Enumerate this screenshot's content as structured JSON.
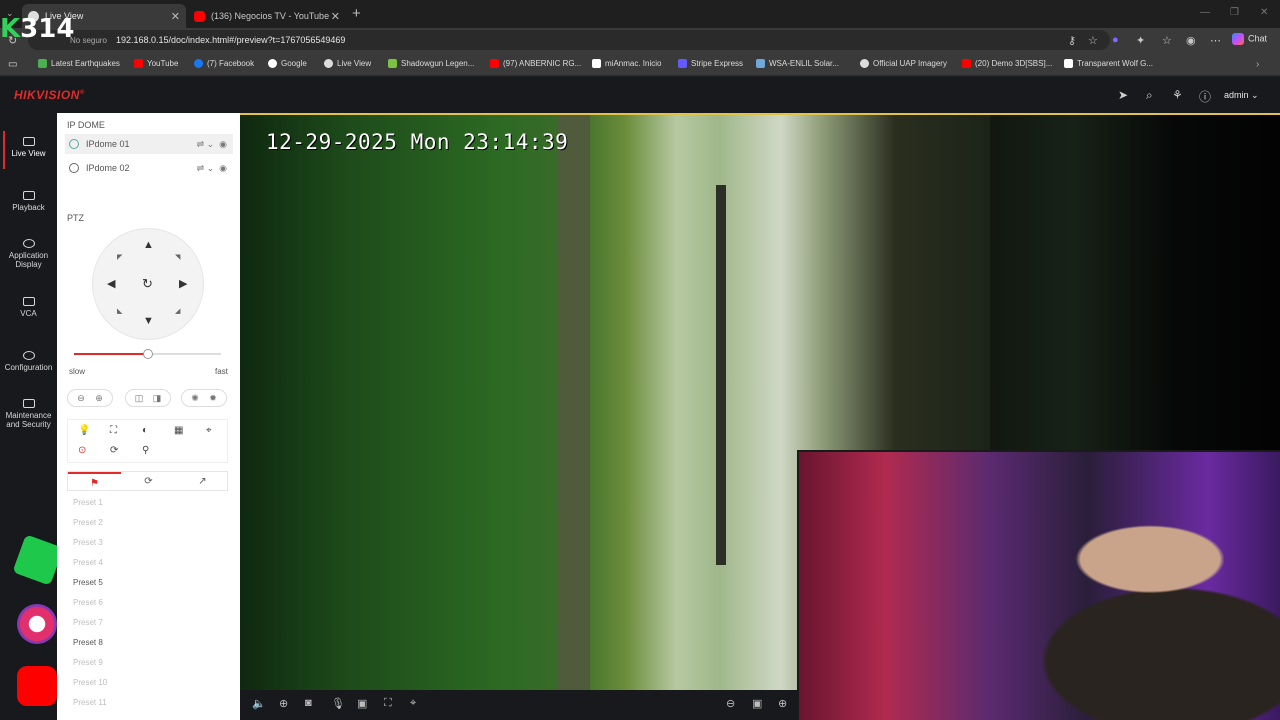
{
  "browser": {
    "tabs": [
      {
        "title": "Live View",
        "active": true
      },
      {
        "title": "(136) Negocios TV - YouTube",
        "active": false
      }
    ],
    "security_label": "No seguro",
    "url": "192.168.0.15/doc/index.html#/preview?t=1767056549469",
    "chat_label": "Chat",
    "bookmarks": [
      {
        "label": "Latest Earthquakes",
        "color": "#4caf50"
      },
      {
        "label": "YouTube",
        "color": "#ff0000"
      },
      {
        "label": "(7) Facebook",
        "color": "#1877f2"
      },
      {
        "label": "Google",
        "color": "#ffffff"
      },
      {
        "label": "Live View",
        "color": "#dddddd"
      },
      {
        "label": "Shadowgun Legen...",
        "color": "#7bc142"
      },
      {
        "label": "(97) ANBERNIC RG...",
        "color": "#ff0000"
      },
      {
        "label": "miAnmac. Inicio",
        "color": "#ffffff"
      },
      {
        "label": "Stripe Express",
        "color": "#635bff"
      },
      {
        "label": "WSA-ENLIL Solar...",
        "color": "#6fa8dc"
      },
      {
        "label": "Official UAP Imagery",
        "color": "#dddddd"
      },
      {
        "label": "(20) Demo 3D[SBS]...",
        "color": "#ff0000"
      },
      {
        "label": "Transparent Wolf G...",
        "color": "#ffffff"
      }
    ]
  },
  "overlay": {
    "text": "314",
    "prefix": "K"
  },
  "app": {
    "brand": "HIKVISION",
    "brand_mark": "®",
    "user": "admin",
    "nav": [
      {
        "label": "Live View",
        "active": true
      },
      {
        "label": "Playback"
      },
      {
        "label": "Application Display"
      },
      {
        "label": "VCA"
      },
      {
        "label": "Configuration"
      },
      {
        "label": "Maintenance and Security"
      }
    ],
    "panel": {
      "group_title": "IP DOME",
      "cameras": [
        "IPdome 01",
        "IPdome 02"
      ],
      "ptz_title": "PTZ",
      "speed_slow": "slow",
      "speed_fast": "fast",
      "speed_level": 0.5,
      "presets": [
        {
          "label": "Preset 1",
          "set": false
        },
        {
          "label": "Preset 2",
          "set": false
        },
        {
          "label": "Preset 3",
          "set": false
        },
        {
          "label": "Preset 4",
          "set": false
        },
        {
          "label": "Preset 5",
          "set": true
        },
        {
          "label": "Preset 6",
          "set": false
        },
        {
          "label": "Preset 7",
          "set": false
        },
        {
          "label": "Preset 8",
          "set": true
        },
        {
          "label": "Preset 9",
          "set": false
        },
        {
          "label": "Preset 10",
          "set": false
        },
        {
          "label": "Preset 11",
          "set": false
        }
      ]
    },
    "video": {
      "timestamp": "12-29-2025 Mon 23:14:39"
    }
  },
  "colors": {
    "accent": "#e12b2b"
  }
}
